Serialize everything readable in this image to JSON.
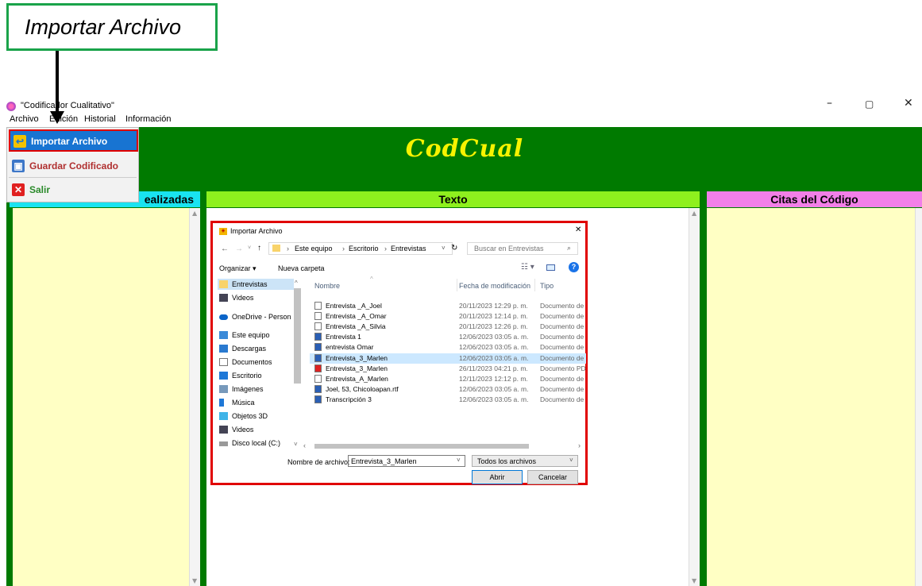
{
  "callout": {
    "text": "Importar Archivo"
  },
  "window": {
    "title": "\"Codificador Cualitativo\"",
    "controls": [
      "–",
      "▢",
      "✕"
    ]
  },
  "menubar": {
    "items": [
      "Archivo",
      "Edición",
      "Historial",
      "Información"
    ]
  },
  "dropdown": {
    "items": [
      {
        "label": "Importar Archivo",
        "icon": "import-arrow-icon",
        "color": "#ffffff"
      },
      {
        "label": "Guardar Codificado",
        "icon": "save-disk-icon",
        "color": "#b03030"
      },
      {
        "label": "Salir",
        "icon": "close-x-icon",
        "color": "#2a8a2a"
      }
    ]
  },
  "app": {
    "header": "CodCual",
    "header_color": "#f7f300",
    "bg": "#007a00"
  },
  "panels": {
    "left": {
      "title": "Lista de Codificaciones Realizadas",
      "visible_title": "ealizadas",
      "head_color": "#19e3f0"
    },
    "center": {
      "title": "Texto",
      "head_color": "#8ef01e"
    },
    "right": {
      "title": "Citas del Código",
      "head_color": "#f27fe8"
    }
  },
  "dialog": {
    "title": "Importar Archivo",
    "breadcrumb": [
      "Este equipo",
      "Escritorio",
      "Entrevistas"
    ],
    "search_placeholder": "Buscar en Entrevistas",
    "toolbar": {
      "organize": "Organizar ▾",
      "new_folder": "Nueva carpeta"
    },
    "nav": [
      "Entrevistas",
      "Videos",
      "OneDrive - Person",
      "Este equipo",
      "Descargas",
      "Documentos",
      "Escritorio",
      "Imágenes",
      "Música",
      "Objetos 3D",
      "Videos",
      "Disco local (C:)"
    ],
    "columns": [
      "Nombre",
      "Fecha de modificación",
      "Tipo"
    ],
    "files": [
      {
        "name": "Entrevista _A_Joel",
        "date": "20/11/2023 12:29 p. m.",
        "type": "Documento de"
      },
      {
        "name": "Entrevista _A_Omar",
        "date": "20/11/2023 12:14 p. m.",
        "type": "Documento de"
      },
      {
        "name": "Entrevista _A_Silvia",
        "date": "20/11/2023 12:26 p. m.",
        "type": "Documento de"
      },
      {
        "name": "Entrevista 1",
        "date": "12/06/2023 03:05 a. m.",
        "type": "Documento de"
      },
      {
        "name": "entrevista Omar",
        "date": "12/06/2023 03:05 a. m.",
        "type": "Documento de"
      },
      {
        "name": "Entrevista_3_Marlen",
        "date": "12/06/2023 03:05 a. m.",
        "type": "Documento de"
      },
      {
        "name": "Entrevista_3_Marlen",
        "date": "26/11/2023 04:21 p. m.",
        "type": "Documento PD"
      },
      {
        "name": "Entrevista_A_Marlen",
        "date": "12/11/2023 12:12 p. m.",
        "type": "Documento de"
      },
      {
        "name": "Joel, 53, Chicoloapan.rtf",
        "date": "12/06/2023 03:05 a. m.",
        "type": "Documento de"
      },
      {
        "name": "Transcripción 3",
        "date": "12/06/2023 03:05 a. m.",
        "type": "Documento de"
      }
    ],
    "filename_label": "Nombre de archivo:",
    "filename_value": "Entrevista_3_Marlen",
    "filter": "Todos los archivos",
    "open": "Abrir",
    "cancel": "Cancelar"
  }
}
